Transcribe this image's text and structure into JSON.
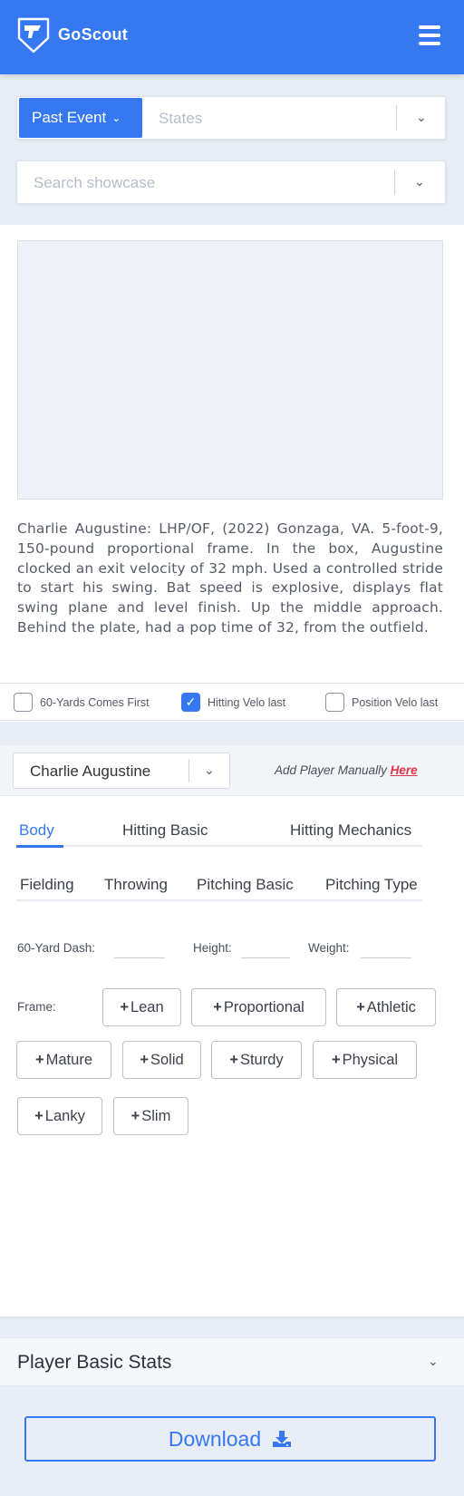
{
  "header": {
    "brand": "GoScout"
  },
  "filters": {
    "event_button": "Past Event",
    "states_placeholder": "States",
    "search_placeholder": "Search showcase"
  },
  "report": {
    "description": "Charlie Augustine: LHP/OF, (2022) Gonzaga, VA. 5-foot-9, 150-pound proportional frame. In the box, Augustine clocked an exit velocity of 32 mph. Used a controlled stride to start his swing. Bat speed is explosive, displays flat  swing plane and level finish. Up the middle approach. Behind the plate, had a pop time of 32, from the outfield."
  },
  "order_options": [
    {
      "label": "60-Yards Comes First",
      "checked": false
    },
    {
      "label": "Hitting Velo last",
      "checked": true
    },
    {
      "label": "Position Velo last",
      "checked": false
    }
  ],
  "player": {
    "selected": "Charlie Augustine",
    "add_text": "Add Player Manually",
    "add_link": "Here"
  },
  "tabs": {
    "row1": [
      "Body",
      "Hitting Basic",
      "Hitting Mechanics"
    ],
    "row2": [
      "Fielding",
      "Throwing",
      "Pitching Basic",
      "Pitching Type"
    ],
    "active": "Body"
  },
  "body_fields": {
    "dash_label": "60-Yard Dash:",
    "height_label": "Height:",
    "weight_label": "Weight:",
    "frame_label": "Frame:"
  },
  "frame_options": [
    "Lean",
    "Proportional",
    "Athletic",
    "Mature",
    "Solid",
    "Sturdy",
    "Physical",
    "Lanky",
    "Slim"
  ],
  "stats": {
    "title": "Player Basic Stats"
  },
  "download": {
    "label": "Download"
  },
  "colors": {
    "primary": "#3578f2",
    "link": "#e0344a",
    "background": "#e9eef6"
  },
  "icons": [
    "shield-camera-logo",
    "hamburger-menu-icon",
    "chevron-down-icon",
    "checkmark-icon",
    "plus-icon",
    "download-icon"
  ]
}
